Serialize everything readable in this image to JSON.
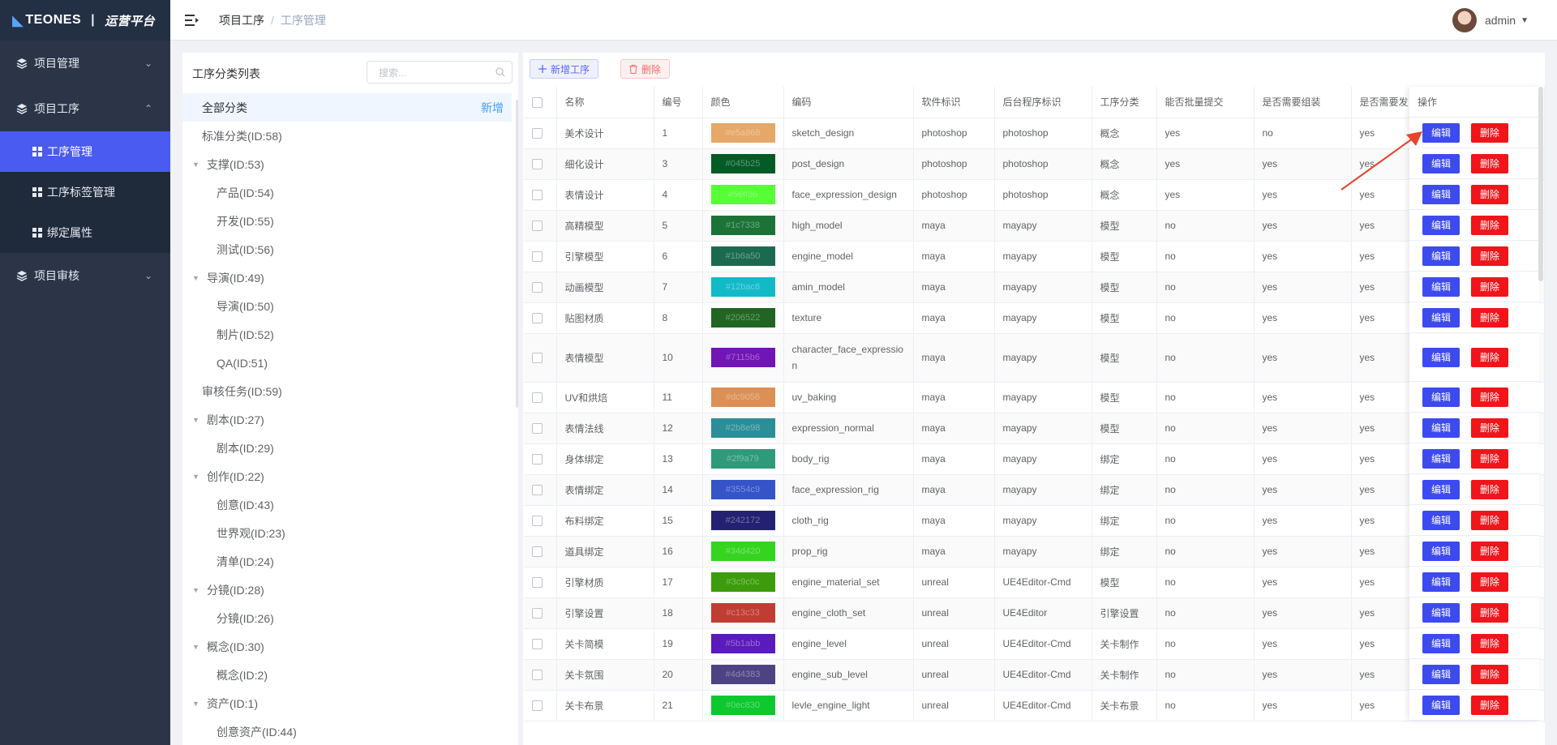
{
  "sidebar": {
    "logo_brand": "TEONES",
    "logo_sep": "|",
    "logo_sub": "运营平台",
    "menu": [
      {
        "label": "项目管理",
        "chevron": "v"
      },
      {
        "label": "项目工序",
        "chevron": "^"
      },
      {
        "label": "项目审核",
        "chevron": "v"
      }
    ],
    "submenu": [
      "工序管理",
      "工序标签管理",
      "绑定属性"
    ]
  },
  "header": {
    "breadcrumb": [
      "项目工序",
      "工序管理"
    ],
    "user": "admin"
  },
  "category": {
    "title": "工序分类列表",
    "search_placeholder": "搜索...",
    "add_label": "新增",
    "items": [
      {
        "label": "全部分类",
        "level": 0,
        "expand": "",
        "selected": true
      },
      {
        "label": "标准分类(ID:58)",
        "level": 0,
        "expand": ""
      },
      {
        "label": "支撑(ID:53)",
        "level": 0,
        "expand": "down"
      },
      {
        "label": "产品(ID:54)",
        "level": 1,
        "expand": ""
      },
      {
        "label": "开发(ID:55)",
        "level": 1,
        "expand": ""
      },
      {
        "label": "测试(ID:56)",
        "level": 1,
        "expand": ""
      },
      {
        "label": "导演(ID:49)",
        "level": 0,
        "expand": "down"
      },
      {
        "label": "导演(ID:50)",
        "level": 1,
        "expand": ""
      },
      {
        "label": "制片(ID:52)",
        "level": 1,
        "expand": ""
      },
      {
        "label": "QA(ID:51)",
        "level": 1,
        "expand": ""
      },
      {
        "label": "审核任务(ID:59)",
        "level": 0,
        "expand": ""
      },
      {
        "label": "剧本(ID:27)",
        "level": 0,
        "expand": "down"
      },
      {
        "label": "剧本(ID:29)",
        "level": 1,
        "expand": ""
      },
      {
        "label": "创作(ID:22)",
        "level": 0,
        "expand": "down"
      },
      {
        "label": "创意(ID:43)",
        "level": 1,
        "expand": ""
      },
      {
        "label": "世界观(ID:23)",
        "level": 1,
        "expand": ""
      },
      {
        "label": "清单(ID:24)",
        "level": 1,
        "expand": ""
      },
      {
        "label": "分镜(ID:28)",
        "level": 0,
        "expand": "down"
      },
      {
        "label": "分镜(ID:26)",
        "level": 1,
        "expand": ""
      },
      {
        "label": "概念(ID:30)",
        "level": 0,
        "expand": "down"
      },
      {
        "label": "概念(ID:2)",
        "level": 1,
        "expand": ""
      },
      {
        "label": "资产(ID:1)",
        "level": 0,
        "expand": "down"
      },
      {
        "label": "创意资产(ID:44)",
        "level": 1,
        "expand": ""
      }
    ]
  },
  "toolbar": {
    "new_label": "新增工序",
    "delete_label": "删除"
  },
  "table": {
    "columns": [
      "名称",
      "编号",
      "颜色",
      "编码",
      "软件标识",
      "后台程序标识",
      "工序分类",
      "能否批量提交",
      "是否需要组装",
      "是否需要发"
    ],
    "op_header": "操作",
    "edit_label": "编辑",
    "delete_label": "删除",
    "rows": [
      {
        "name": "美术设计",
        "num": "1",
        "color": "#e5a868",
        "code": "sketch_design",
        "software": "photoshop",
        "backend": "photoshop",
        "category": "概念",
        "batch": "yes",
        "assemble": "no",
        "publish": "yes"
      },
      {
        "name": "细化设计",
        "num": "3",
        "color": "#045b25",
        "code": "post_design",
        "software": "photoshop",
        "backend": "photoshop",
        "category": "概念",
        "batch": "yes",
        "assemble": "yes",
        "publish": "yes"
      },
      {
        "name": "表情设计",
        "num": "4",
        "color": "#56ff36",
        "code": "face_expression_design",
        "software": "photoshop",
        "backend": "photoshop",
        "category": "概念",
        "batch": "yes",
        "assemble": "yes",
        "publish": "yes"
      },
      {
        "name": "高精模型",
        "num": "5",
        "color": "#1c7338",
        "code": "high_model",
        "software": "maya",
        "backend": "mayapy",
        "category": "模型",
        "batch": "no",
        "assemble": "yes",
        "publish": "yes"
      },
      {
        "name": "引擎模型",
        "num": "6",
        "color": "#1b6a50",
        "code": "engine_model",
        "software": "maya",
        "backend": "mayapy",
        "category": "模型",
        "batch": "no",
        "assemble": "yes",
        "publish": "yes"
      },
      {
        "name": "动画模型",
        "num": "7",
        "color": "#12bac8",
        "code": "amin_model",
        "software": "maya",
        "backend": "mayapy",
        "category": "模型",
        "batch": "no",
        "assemble": "yes",
        "publish": "yes"
      },
      {
        "name": "贴图材质",
        "num": "8",
        "color": "#206522",
        "code": "texture",
        "software": "maya",
        "backend": "mayapy",
        "category": "模型",
        "batch": "no",
        "assemble": "yes",
        "publish": "yes"
      },
      {
        "name": "表情模型",
        "num": "10",
        "color": "#7115b6",
        "code": "character_face_expression",
        "software": "maya",
        "backend": "mayapy",
        "category": "模型",
        "batch": "no",
        "assemble": "yes",
        "publish": "yes",
        "tall": true
      },
      {
        "name": "UV和烘焙",
        "num": "11",
        "color": "#dc9056",
        "code": "uv_baking",
        "software": "maya",
        "backend": "mayapy",
        "category": "模型",
        "batch": "no",
        "assemble": "yes",
        "publish": "yes"
      },
      {
        "name": "表情法线",
        "num": "12",
        "color": "#2b8e98",
        "code": "expression_normal",
        "software": "maya",
        "backend": "mayapy",
        "category": "模型",
        "batch": "no",
        "assemble": "yes",
        "publish": "yes"
      },
      {
        "name": "身体绑定",
        "num": "13",
        "color": "#2f9a79",
        "code": "body_rig",
        "software": "maya",
        "backend": "mayapy",
        "category": "绑定",
        "batch": "no",
        "assemble": "yes",
        "publish": "yes"
      },
      {
        "name": "表情绑定",
        "num": "14",
        "color": "#3554c9",
        "code": "face_expression_rig",
        "software": "maya",
        "backend": "mayapy",
        "category": "绑定",
        "batch": "no",
        "assemble": "yes",
        "publish": "yes"
      },
      {
        "name": "布料绑定",
        "num": "15",
        "color": "#242172",
        "code": "cloth_rig",
        "software": "maya",
        "backend": "mayapy",
        "category": "绑定",
        "batch": "no",
        "assemble": "yes",
        "publish": "yes"
      },
      {
        "name": "道具绑定",
        "num": "16",
        "color": "#34d420",
        "code": "prop_rig",
        "software": "maya",
        "backend": "mayapy",
        "category": "绑定",
        "batch": "no",
        "assemble": "yes",
        "publish": "yes"
      },
      {
        "name": "引擎材质",
        "num": "17",
        "color": "#3c9c0c",
        "code": "engine_material_set",
        "software": "unreal",
        "backend": "UE4Editor-Cmd",
        "category": "模型",
        "batch": "no",
        "assemble": "yes",
        "publish": "yes"
      },
      {
        "name": "引擎设置",
        "num": "18",
        "color": "#c13c33",
        "code": "engine_cloth_set",
        "software": "unreal",
        "backend": "UE4Editor",
        "category": "引擎设置",
        "batch": "no",
        "assemble": "yes",
        "publish": "yes"
      },
      {
        "name": "关卡简模",
        "num": "19",
        "color": "#5b1abb",
        "code": "engine_level",
        "software": "unreal",
        "backend": "UE4Editor-Cmd",
        "category": "关卡制作",
        "batch": "no",
        "assemble": "yes",
        "publish": "yes"
      },
      {
        "name": "关卡氛围",
        "num": "20",
        "color": "#4d4383",
        "code": "engine_sub_level",
        "software": "unreal",
        "backend": "UE4Editor-Cmd",
        "category": "关卡制作",
        "batch": "no",
        "assemble": "yes",
        "publish": "yes"
      },
      {
        "name": "关卡布景",
        "num": "21",
        "color": "#0ec830",
        "code": "levle_engine_light",
        "software": "unreal",
        "backend": "UE4Editor-Cmd",
        "category": "关卡布景",
        "batch": "no",
        "assemble": "yes",
        "publish": "yes"
      }
    ]
  },
  "colors": {
    "sidebar_bg": "#2b3547",
    "active": "#4a5bf2",
    "edit_btn": "#3d4af0",
    "delete_btn": "#f0151a",
    "annotation_arrow": "#e8442f"
  }
}
